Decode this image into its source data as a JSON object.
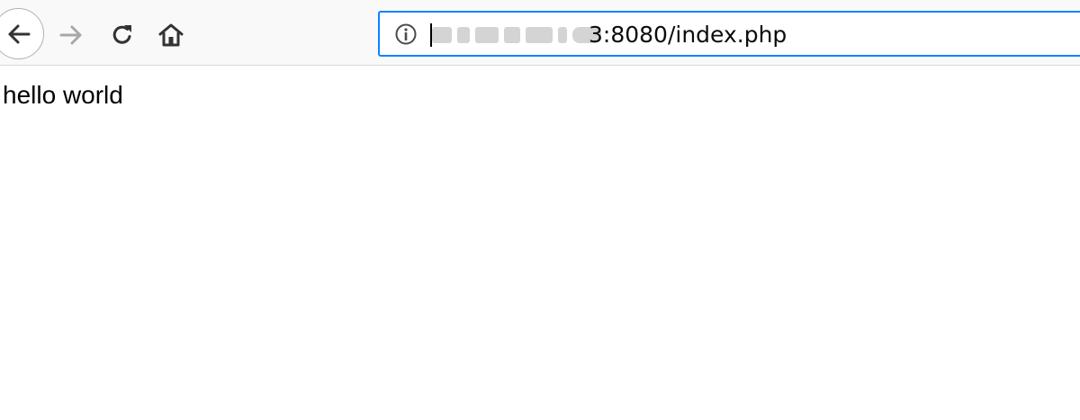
{
  "browser": {
    "toolbar": {
      "back_icon": "arrow-left-icon",
      "forward_icon": "arrow-right-icon",
      "reload_icon": "reload-icon",
      "home_icon": "home-icon",
      "forward_disabled": true
    },
    "urlbar": {
      "site_info_icon": "info-icon",
      "url_visible_suffix": "3:8080/index.php",
      "url_prefix_obscured": true,
      "focus_color": "#0a84ff"
    }
  },
  "page": {
    "body_text": "hello world"
  }
}
